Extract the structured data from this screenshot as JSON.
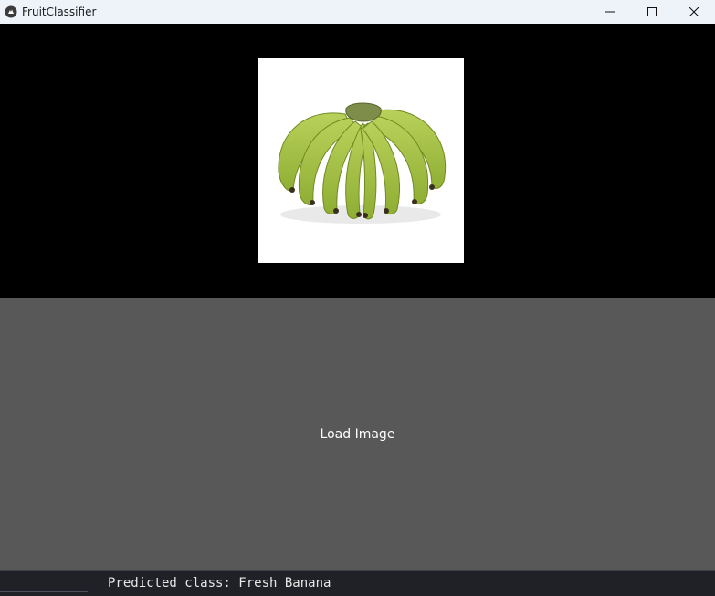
{
  "window": {
    "title": "FruitClassifier",
    "icons": {
      "app": "kivy-logo-icon",
      "minimize": "minimize-icon",
      "maximize": "maximize-icon",
      "close": "close-icon"
    }
  },
  "image_panel": {
    "image_subject": "banana-bunch-image"
  },
  "load_button": {
    "label": "Load Image"
  },
  "status": {
    "prediction_text": "Predicted class: Fresh Banana"
  },
  "colors": {
    "titlebar_bg": "#eef3fa",
    "image_area_bg": "#000000",
    "button_bg": "#585858",
    "status_bg": "#202126",
    "banana_green": "#a6c24a"
  }
}
